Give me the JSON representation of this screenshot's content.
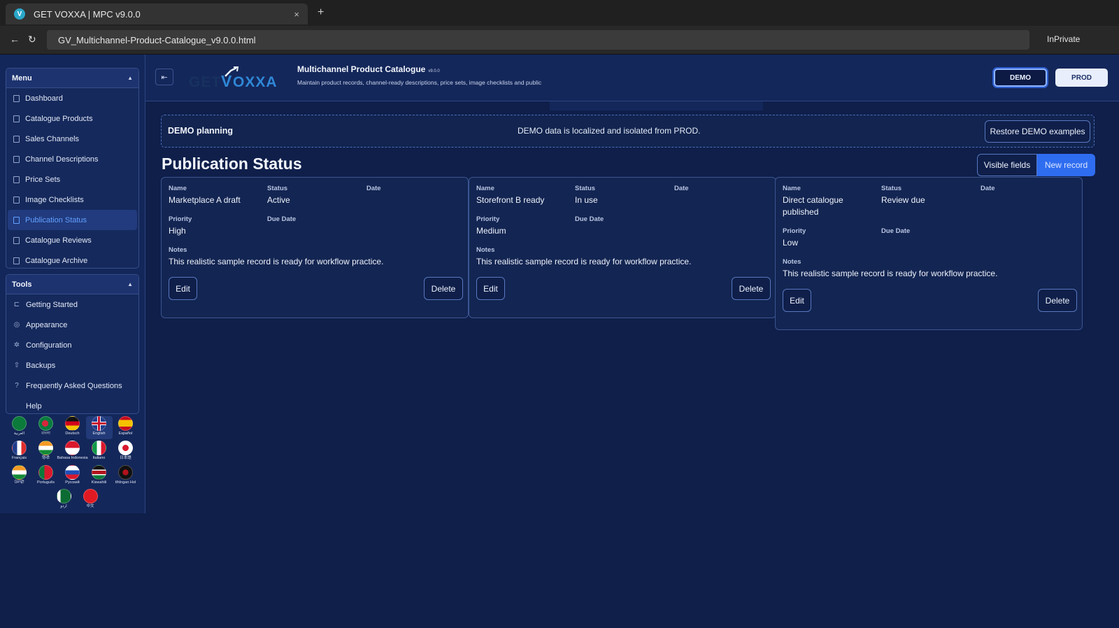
{
  "browser": {
    "tab_title": "GET VOXXA | MPC v9.0.0",
    "tab_favicon": "V",
    "tab_close": "×",
    "new_tab": "+",
    "back": "←",
    "reload": "↻",
    "url": "GV_Multichannel-Product-Catalogue_v9.0.0.html",
    "mode": "InPrivate"
  },
  "sidebar": {
    "menu_title": "Menu",
    "menu_items": [
      {
        "label": "Dashboard",
        "active": false
      },
      {
        "label": "Catalogue Products",
        "active": false
      },
      {
        "label": "Sales Channels",
        "active": false
      },
      {
        "label": "Channel Descriptions",
        "active": false
      },
      {
        "label": "Price Sets",
        "active": false
      },
      {
        "label": "Image Checklists",
        "active": false
      },
      {
        "label": "Publication Status",
        "active": true
      },
      {
        "label": "Catalogue Reviews",
        "active": false
      },
      {
        "label": "Catalogue Archive",
        "active": false
      }
    ],
    "tools_title": "Tools",
    "tool_items": [
      {
        "label": "Getting Started",
        "icon": "book-icon"
      },
      {
        "label": "Appearance",
        "icon": "palette-icon"
      },
      {
        "label": "Configuration",
        "icon": "gear-icon"
      },
      {
        "label": "Backups",
        "icon": "upload-icon"
      },
      {
        "label": "Frequently Asked Questions",
        "icon": "question-icon"
      },
      {
        "label": "Help",
        "icon": ""
      }
    ],
    "languages": [
      {
        "label": "العربية",
        "icon": "saudi-flag-icon",
        "selected": false
      },
      {
        "label": "বাংলা",
        "icon": "bangladesh-flag-icon",
        "selected": false
      },
      {
        "label": "Deutsch",
        "icon": "germany-flag-icon",
        "selected": false
      },
      {
        "label": "English",
        "icon": "uk-flag-icon",
        "selected": true
      },
      {
        "label": "Español",
        "icon": "spain-flag-icon",
        "selected": false
      },
      {
        "label": "Français",
        "icon": "france-flag-icon",
        "selected": false
      },
      {
        "label": "हिन्दी",
        "icon": "india-flag-icon",
        "selected": false
      },
      {
        "label": "Bahasa Indonesia",
        "icon": "indonesia-flag-icon",
        "selected": false
      },
      {
        "label": "Italiano",
        "icon": "italy-flag-icon",
        "selected": false
      },
      {
        "label": "日本語",
        "icon": "japan-flag-icon",
        "selected": false
      },
      {
        "label": "ਪੰਜਾਬੀ",
        "icon": "india-flag-icon",
        "selected": false
      },
      {
        "label": "Português",
        "icon": "portugal-flag-icon",
        "selected": false
      },
      {
        "label": "Русский",
        "icon": "russia-flag-icon",
        "selected": false
      },
      {
        "label": "Kiswahili",
        "icon": "kenya-flag-icon",
        "selected": false
      },
      {
        "label": "tlhIngan Hol",
        "icon": "klingon-flag-icon",
        "selected": false
      },
      {
        "label": "اردو",
        "icon": "pakistan-flag-icon",
        "selected": false
      },
      {
        "label": "中文",
        "icon": "china-flag-icon",
        "selected": false
      }
    ]
  },
  "header": {
    "logo_text": "GETVOXXA",
    "title": "Multichannel Product Catalogue",
    "version": "v9.0.0",
    "subtitle": "Maintain product records, channel-ready descriptions, price sets, image checklists and public",
    "demo_label": "DEMO",
    "prod_label": "PROD"
  },
  "banner": {
    "title": "DEMO planning",
    "message": "DEMO data is localized and isolated from PROD.",
    "restore_label": "Restore DEMO examples"
  },
  "page": {
    "title": "Publication Status",
    "visible_fields_label": "Visible fields",
    "new_record_label": "New record"
  },
  "field_labels": {
    "name": "Name",
    "status": "Status",
    "date": "Date",
    "priority": "Priority",
    "due_date": "Due Date",
    "notes": "Notes"
  },
  "actions": {
    "edit": "Edit",
    "delete": "Delete"
  },
  "records": [
    {
      "name": "Marketplace A draft",
      "status": "Active",
      "date": "",
      "priority": "High",
      "due_date": "",
      "notes": "This realistic sample record is ready for workflow practice."
    },
    {
      "name": "Storefront B ready",
      "status": "In use",
      "date": "",
      "priority": "Medium",
      "due_date": "",
      "notes": "This realistic sample record is ready for workflow practice."
    },
    {
      "name": "Direct catalogue published",
      "status": "Review due",
      "date": "",
      "priority": "Low",
      "due_date": "",
      "notes": "This realistic sample record is ready for workflow practice."
    }
  ],
  "colors": {
    "background": "#0f1f4a",
    "panel": "#14275a",
    "accent": "#2f6df0",
    "active_text": "#63a0ff"
  }
}
